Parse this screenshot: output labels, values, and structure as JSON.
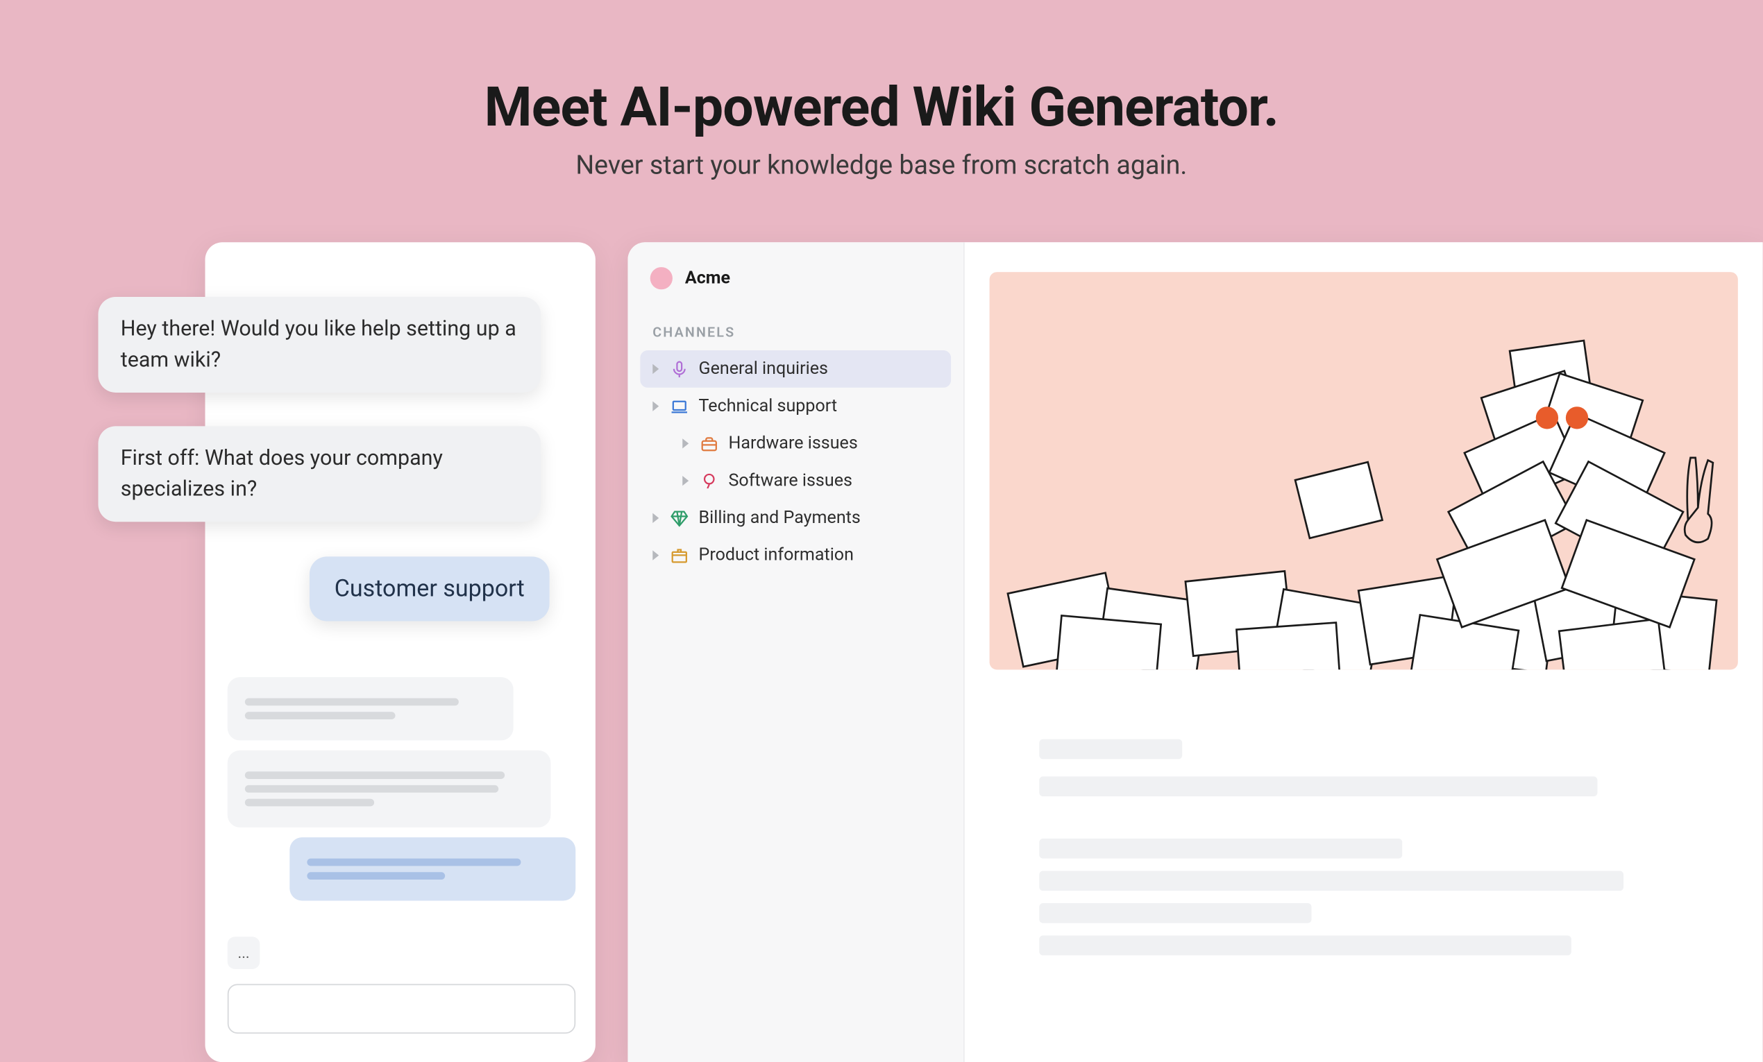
{
  "hero": {
    "title": "Meet AI-powered Wiki Generator.",
    "subtitle": "Never start your knowledge base from scratch again."
  },
  "chat": {
    "messages": [
      "Hey there! Would you like help setting up a team wiki?",
      "First off: What does your company specializes in?"
    ],
    "reply": "Customer support",
    "ellipsis": "..."
  },
  "app": {
    "workspace_name": "Acme",
    "section_label": "CHANNELS",
    "channels": [
      {
        "label": "General inquiries",
        "icon": "microphone-icon",
        "color": "#b06fd6",
        "active": true,
        "depth": 0
      },
      {
        "label": "Technical support",
        "icon": "laptop-icon",
        "color": "#3b78d6",
        "active": false,
        "depth": 0
      },
      {
        "label": "Hardware issues",
        "icon": "toolbox-icon",
        "color": "#e07a3f",
        "active": false,
        "depth": 1
      },
      {
        "label": "Software issues",
        "icon": "balloon-icon",
        "color": "#d63b5e",
        "active": false,
        "depth": 1
      },
      {
        "label": "Billing and Payments",
        "icon": "diamond-icon",
        "color": "#2f9d6a",
        "active": false,
        "depth": 0
      },
      {
        "label": "Product information",
        "icon": "package-icon",
        "color": "#d69a2f",
        "active": false,
        "depth": 0
      }
    ]
  }
}
